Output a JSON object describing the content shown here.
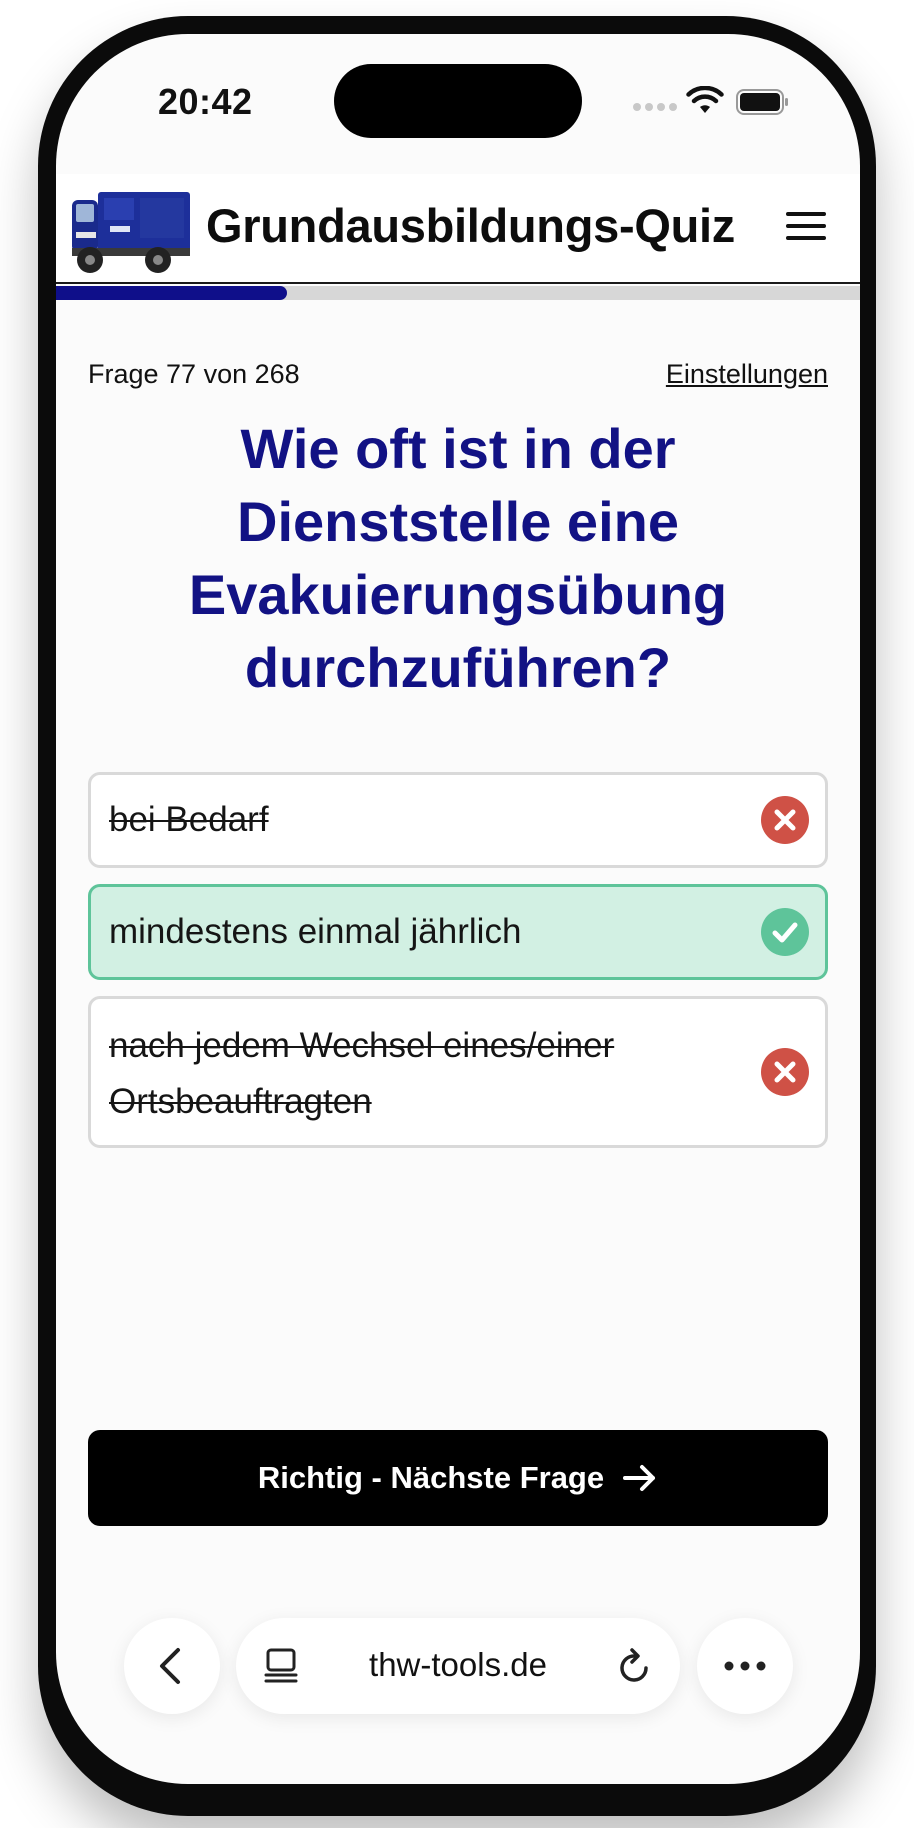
{
  "status_bar": {
    "time": "20:42"
  },
  "header": {
    "title": "Grundausbildungs-Quiz",
    "logo_icon": "fire-truck-logo",
    "menu_icon": "hamburger-menu-icon"
  },
  "progress": {
    "current": 77,
    "total": 268,
    "fraction": 0.287,
    "fill_color": "#0f0f8a"
  },
  "quiz": {
    "counter_label": "Frage 77 von 268",
    "settings_label": "Einstellungen",
    "question": "Wie oft ist in der Dienststelle eine Evakuierungsübung durchzuführen?",
    "answers": [
      {
        "text": "bei Bedarf",
        "state": "wrong"
      },
      {
        "text": "mindestens einmal jährlich",
        "state": "correct"
      },
      {
        "text": "nach jedem Wechsel eines/einer Ortsbeauftragten",
        "state": "wrong"
      }
    ],
    "next_button_label": "Richtig - Nächste Frage",
    "next_button_icon": "arrow-right-icon"
  },
  "browser": {
    "url": "thw-tools.de",
    "back_icon": "chevron-left-icon",
    "tabs_icon": "tabs-icon",
    "reload_icon": "reload-icon",
    "more_icon": "more-dots-icon"
  },
  "colors": {
    "accent": "#121284",
    "correct_bg": "#d2f0e3",
    "correct_border": "#5ec49a",
    "wrong_icon": "#cf5146"
  }
}
